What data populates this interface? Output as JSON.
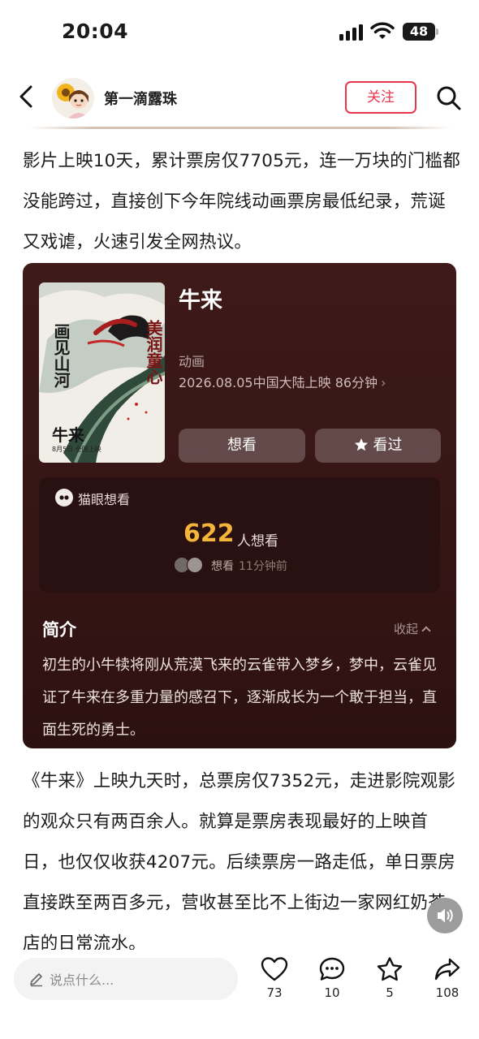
{
  "status_bar": {
    "time": "20:04",
    "battery": "48"
  },
  "header": {
    "author": "第一滴露珠",
    "follow_label": "关注"
  },
  "article": {
    "para1": "影片上映10天，累计票房仅7705元，连一万块的门槛都没能跨过，直接创下今年院线动画票房最低纪录，荒诞又戏谑，火速引发全网热议。",
    "para2": "《牛来》上映九天时，总票房仅7352元，走进影院观影的观众只有两百余人。就算是票房表现最好的上映首日，也仅仅收获4207元。后续票房一路走低，单日票房直接跌至两百多元，营收甚至比不上街边一家网红奶茶店的日常流水。"
  },
  "movie": {
    "title": "牛来",
    "genre": "动画",
    "release": "2026.08.05中国大陆上映 86分钟",
    "want_label": "想看",
    "seen_label": "看过",
    "poster": {
      "left_title": "画见山河",
      "right_title": "美润童心",
      "name": "牛来",
      "date": "8月5日 全国上映"
    },
    "maoyan": {
      "label": "猫眼想看",
      "count": "622",
      "unit": "人想看",
      "recent_action": "想看",
      "recent_time": "11分钟前"
    },
    "intro": {
      "title": "简介",
      "collapse_label": "收起",
      "text": "初生的小牛犊将刚从荒漠飞来的云雀带入梦乡，梦中，云雀见证了牛来在多重力量的感召下，逐渐成长为一个敢于担当，直面生死的勇士。"
    }
  },
  "bottom_bar": {
    "comment_placeholder": "说点什么...",
    "likes": "73",
    "comments": "10",
    "favorites": "5",
    "shares": "108"
  },
  "colors": {
    "accent": "#e9364f",
    "card_bg": "#3e1a19",
    "want_count": "#f5b53b"
  }
}
